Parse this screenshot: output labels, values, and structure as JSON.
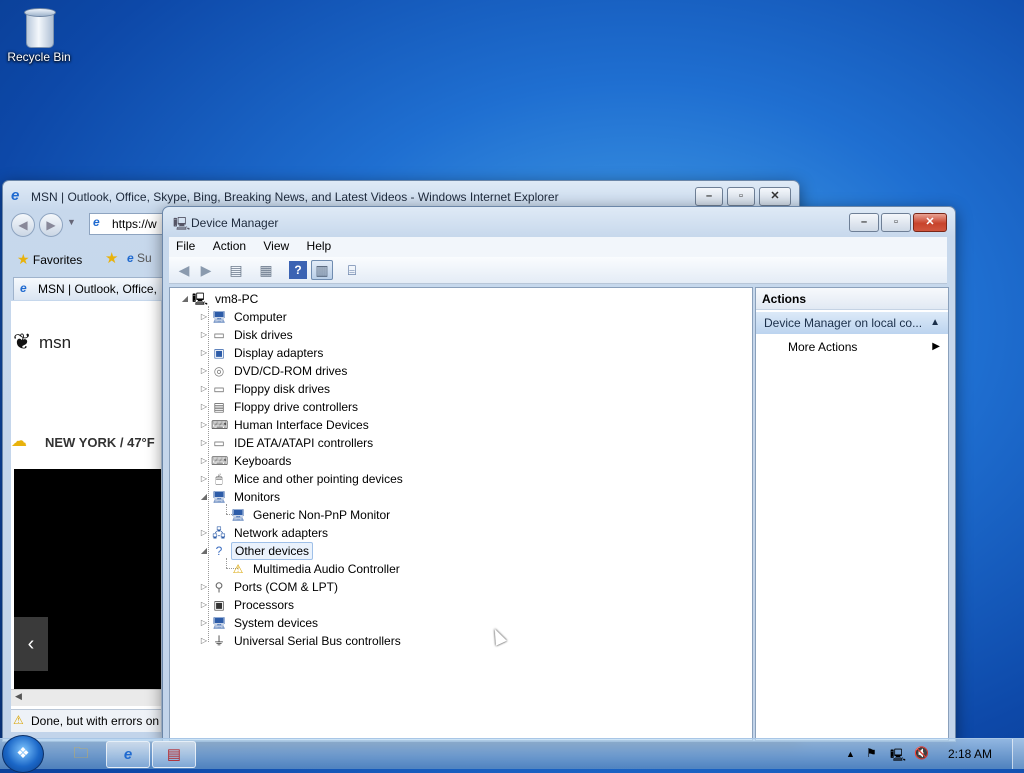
{
  "desktop": {
    "recycle_bin_label": "Recycle Bin"
  },
  "ie_window": {
    "title": "MSN | Outlook, Office, Skype, Bing, Breaking News, and Latest Videos - Windows Internet Explorer",
    "address_value": "https://w",
    "favorites_label": "Favorites",
    "suggested_label": "Su",
    "tab_label": "MSN | Outlook, Office,",
    "msn_logo_text": "msn",
    "weather_text": "NEW YORK / 47°F",
    "status_text": "Done, but with errors on"
  },
  "device_manager": {
    "title": "Device Manager",
    "menu": [
      "File",
      "Action",
      "View",
      "Help"
    ],
    "tree": {
      "root": "vm8-PC",
      "items": [
        {
          "label": "Computer",
          "icon": "computer-icon",
          "expanded": false
        },
        {
          "label": "Disk drives",
          "icon": "disk-drive-icon",
          "expanded": false
        },
        {
          "label": "Display adapters",
          "icon": "display-adapter-icon",
          "expanded": false
        },
        {
          "label": "DVD/CD-ROM drives",
          "icon": "dvd-drive-icon",
          "expanded": false
        },
        {
          "label": "Floppy disk drives",
          "icon": "floppy-drive-icon",
          "expanded": false
        },
        {
          "label": "Floppy drive controllers",
          "icon": "floppy-controller-icon",
          "expanded": false
        },
        {
          "label": "Human Interface Devices",
          "icon": "hid-icon",
          "expanded": false
        },
        {
          "label": "IDE ATA/ATAPI controllers",
          "icon": "ide-controller-icon",
          "expanded": false
        },
        {
          "label": "Keyboards",
          "icon": "keyboard-icon",
          "expanded": false
        },
        {
          "label": "Mice and other pointing devices",
          "icon": "mouse-icon",
          "expanded": false
        },
        {
          "label": "Monitors",
          "icon": "monitor-icon",
          "expanded": true
        },
        {
          "label": "Generic Non-PnP Monitor",
          "icon": "monitor-icon",
          "child": true
        },
        {
          "label": "Network adapters",
          "icon": "network-adapter-icon",
          "expanded": false
        },
        {
          "label": "Other devices",
          "icon": "unknown-device-icon",
          "expanded": true,
          "selected": true
        },
        {
          "label": "Multimedia Audio Controller",
          "icon": "warning-device-icon",
          "child": true
        },
        {
          "label": "Ports (COM & LPT)",
          "icon": "port-icon",
          "expanded": false
        },
        {
          "label": "Processors",
          "icon": "processor-icon",
          "expanded": false
        },
        {
          "label": "System devices",
          "icon": "system-device-icon",
          "expanded": false
        },
        {
          "label": "Universal Serial Bus controllers",
          "icon": "usb-icon",
          "expanded": false
        }
      ]
    },
    "actions": {
      "header": "Actions",
      "section": "Device Manager on local co...",
      "more_actions": "More Actions"
    }
  },
  "taskbar": {
    "clock": "2:18 AM"
  }
}
